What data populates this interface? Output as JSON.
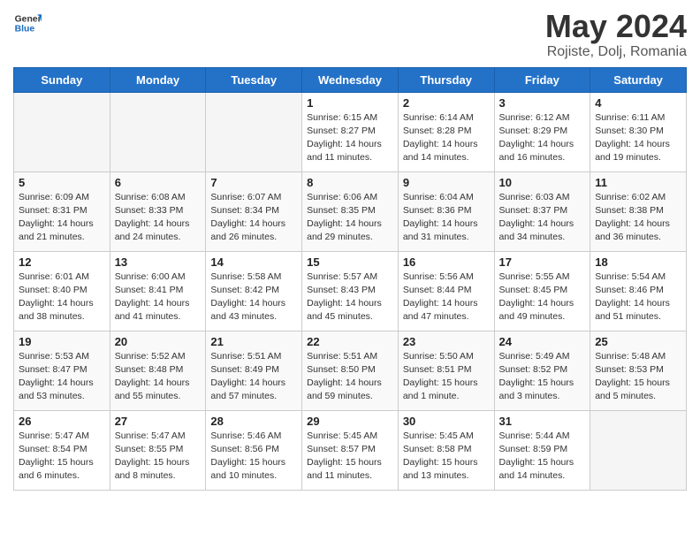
{
  "header": {
    "logo": {
      "general": "General",
      "blue": "Blue"
    },
    "title": "May 2024",
    "location": "Rojiste, Dolj, Romania"
  },
  "weekdays": [
    "Sunday",
    "Monday",
    "Tuesday",
    "Wednesday",
    "Thursday",
    "Friday",
    "Saturday"
  ],
  "weeks": [
    [
      {
        "day": "",
        "info": ""
      },
      {
        "day": "",
        "info": ""
      },
      {
        "day": "",
        "info": ""
      },
      {
        "day": "1",
        "info": "Sunrise: 6:15 AM\nSunset: 8:27 PM\nDaylight: 14 hours\nand 11 minutes."
      },
      {
        "day": "2",
        "info": "Sunrise: 6:14 AM\nSunset: 8:28 PM\nDaylight: 14 hours\nand 14 minutes."
      },
      {
        "day": "3",
        "info": "Sunrise: 6:12 AM\nSunset: 8:29 PM\nDaylight: 14 hours\nand 16 minutes."
      },
      {
        "day": "4",
        "info": "Sunrise: 6:11 AM\nSunset: 8:30 PM\nDaylight: 14 hours\nand 19 minutes."
      }
    ],
    [
      {
        "day": "5",
        "info": "Sunrise: 6:09 AM\nSunset: 8:31 PM\nDaylight: 14 hours\nand 21 minutes."
      },
      {
        "day": "6",
        "info": "Sunrise: 6:08 AM\nSunset: 8:33 PM\nDaylight: 14 hours\nand 24 minutes."
      },
      {
        "day": "7",
        "info": "Sunrise: 6:07 AM\nSunset: 8:34 PM\nDaylight: 14 hours\nand 26 minutes."
      },
      {
        "day": "8",
        "info": "Sunrise: 6:06 AM\nSunset: 8:35 PM\nDaylight: 14 hours\nand 29 minutes."
      },
      {
        "day": "9",
        "info": "Sunrise: 6:04 AM\nSunset: 8:36 PM\nDaylight: 14 hours\nand 31 minutes."
      },
      {
        "day": "10",
        "info": "Sunrise: 6:03 AM\nSunset: 8:37 PM\nDaylight: 14 hours\nand 34 minutes."
      },
      {
        "day": "11",
        "info": "Sunrise: 6:02 AM\nSunset: 8:38 PM\nDaylight: 14 hours\nand 36 minutes."
      }
    ],
    [
      {
        "day": "12",
        "info": "Sunrise: 6:01 AM\nSunset: 8:40 PM\nDaylight: 14 hours\nand 38 minutes."
      },
      {
        "day": "13",
        "info": "Sunrise: 6:00 AM\nSunset: 8:41 PM\nDaylight: 14 hours\nand 41 minutes."
      },
      {
        "day": "14",
        "info": "Sunrise: 5:58 AM\nSunset: 8:42 PM\nDaylight: 14 hours\nand 43 minutes."
      },
      {
        "day": "15",
        "info": "Sunrise: 5:57 AM\nSunset: 8:43 PM\nDaylight: 14 hours\nand 45 minutes."
      },
      {
        "day": "16",
        "info": "Sunrise: 5:56 AM\nSunset: 8:44 PM\nDaylight: 14 hours\nand 47 minutes."
      },
      {
        "day": "17",
        "info": "Sunrise: 5:55 AM\nSunset: 8:45 PM\nDaylight: 14 hours\nand 49 minutes."
      },
      {
        "day": "18",
        "info": "Sunrise: 5:54 AM\nSunset: 8:46 PM\nDaylight: 14 hours\nand 51 minutes."
      }
    ],
    [
      {
        "day": "19",
        "info": "Sunrise: 5:53 AM\nSunset: 8:47 PM\nDaylight: 14 hours\nand 53 minutes."
      },
      {
        "day": "20",
        "info": "Sunrise: 5:52 AM\nSunset: 8:48 PM\nDaylight: 14 hours\nand 55 minutes."
      },
      {
        "day": "21",
        "info": "Sunrise: 5:51 AM\nSunset: 8:49 PM\nDaylight: 14 hours\nand 57 minutes."
      },
      {
        "day": "22",
        "info": "Sunrise: 5:51 AM\nSunset: 8:50 PM\nDaylight: 14 hours\nand 59 minutes."
      },
      {
        "day": "23",
        "info": "Sunrise: 5:50 AM\nSunset: 8:51 PM\nDaylight: 15 hours\nand 1 minute."
      },
      {
        "day": "24",
        "info": "Sunrise: 5:49 AM\nSunset: 8:52 PM\nDaylight: 15 hours\nand 3 minutes."
      },
      {
        "day": "25",
        "info": "Sunrise: 5:48 AM\nSunset: 8:53 PM\nDaylight: 15 hours\nand 5 minutes."
      }
    ],
    [
      {
        "day": "26",
        "info": "Sunrise: 5:47 AM\nSunset: 8:54 PM\nDaylight: 15 hours\nand 6 minutes."
      },
      {
        "day": "27",
        "info": "Sunrise: 5:47 AM\nSunset: 8:55 PM\nDaylight: 15 hours\nand 8 minutes."
      },
      {
        "day": "28",
        "info": "Sunrise: 5:46 AM\nSunset: 8:56 PM\nDaylight: 15 hours\nand 10 minutes."
      },
      {
        "day": "29",
        "info": "Sunrise: 5:45 AM\nSunset: 8:57 PM\nDaylight: 15 hours\nand 11 minutes."
      },
      {
        "day": "30",
        "info": "Sunrise: 5:45 AM\nSunset: 8:58 PM\nDaylight: 15 hours\nand 13 minutes."
      },
      {
        "day": "31",
        "info": "Sunrise: 5:44 AM\nSunset: 8:59 PM\nDaylight: 15 hours\nand 14 minutes."
      },
      {
        "day": "",
        "info": ""
      }
    ]
  ]
}
